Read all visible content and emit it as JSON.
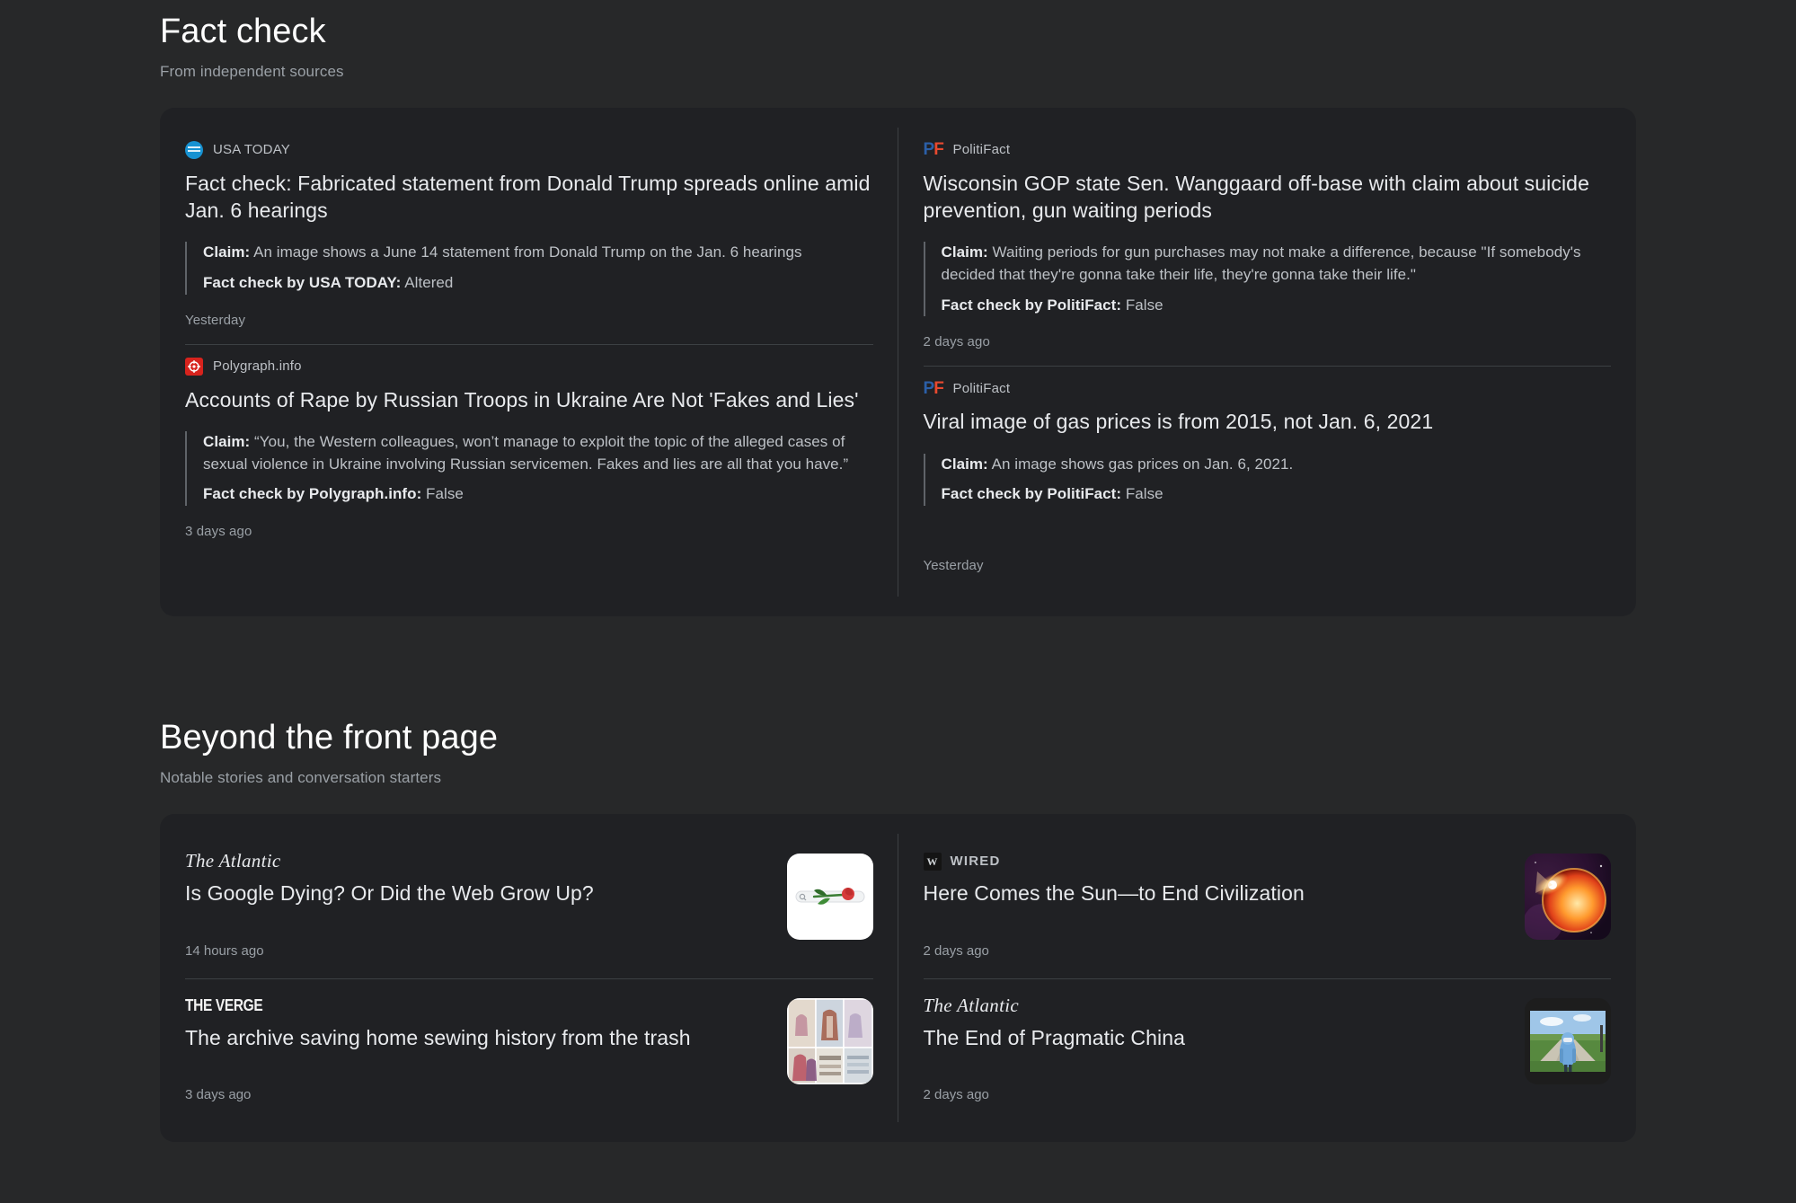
{
  "sections": {
    "fact_check": {
      "title": "Fact check",
      "subtitle": "From independent sources",
      "left": [
        {
          "source": "USA TODAY",
          "logo": "usatoday-logo",
          "headline": "Fact check: Fabricated statement from Donald Trump spreads online amid Jan. 6 hearings",
          "claim_label": "Claim:",
          "claim_text": " An image shows a June 14 statement from Donald Trump on the Jan. 6 hearings",
          "verdict_label": "Fact check by USA TODAY:",
          "verdict_text": " Altered",
          "timestamp": "Yesterday"
        },
        {
          "source": "Polygraph.info",
          "logo": "polygraph-logo",
          "headline": "Accounts of Rape by Russian Troops in Ukraine Are Not 'Fakes and Lies'",
          "claim_label": "Claim:",
          "claim_text": " “You, the Western colleagues, won’t manage to exploit the topic of the alleged cases of sexual violence in Ukraine involving Russian servicemen. Fakes and lies are all that you have.”",
          "verdict_label": "Fact check by Polygraph.info:",
          "verdict_text": " False",
          "timestamp": "3 days ago"
        }
      ],
      "right": [
        {
          "source": "PolitiFact",
          "logo": "politifact-logo",
          "headline": "Wisconsin GOP state Sen. Wanggaard off-base with claim about suicide prevention, gun waiting periods",
          "claim_label": "Claim:",
          "claim_text": " Waiting periods for gun purchases may not make a difference, because \"If somebody's decided that they're gonna take their life, they're gonna take their life.\"",
          "verdict_label": "Fact check by PolitiFact:",
          "verdict_text": " False",
          "timestamp": "2 days ago"
        },
        {
          "source": "PolitiFact",
          "logo": "politifact-logo",
          "headline": "Viral image of gas prices is from 2015, not Jan. 6, 2021",
          "claim_label": "Claim:",
          "claim_text": " An image shows gas prices on Jan. 6, 2021.",
          "verdict_label": "Fact check by PolitiFact:",
          "verdict_text": " False",
          "timestamp": "Yesterday"
        }
      ]
    },
    "beyond": {
      "title": "Beyond the front page",
      "subtitle": "Notable stories and conversation starters",
      "left": [
        {
          "source": "The Atlantic",
          "logo": "atlantic-wordmark",
          "headline": "Is Google Dying? Or Did the Web Grow Up?",
          "timestamp": "14 hours ago",
          "thumbnail": "rose-search-bar-thumbnail"
        },
        {
          "source": "THE VERGE",
          "logo": "verge-wordmark",
          "headline": "The archive saving home sewing history from the trash",
          "timestamp": "3 days ago",
          "thumbnail": "sewing-patterns-grid-thumbnail"
        }
      ],
      "right": [
        {
          "source": "WIRED",
          "logo": "wired-wordmark",
          "headline": "Here Comes the Sun—to End Civilization",
          "timestamp": "2 days ago",
          "thumbnail": "solar-flare-thumbnail"
        },
        {
          "source": "The Atlantic",
          "logo": "atlantic-wordmark",
          "headline": "The End of Pragmatic China",
          "timestamp": "2 days ago",
          "thumbnail": "hazmat-worker-field-thumbnail"
        }
      ]
    }
  },
  "colors": {
    "page_background": "#272829",
    "card_background": "#202124",
    "divider": "#3c4043",
    "title_text": "#e8eaed",
    "muted_text": "#9aa0a6",
    "body_text": "#bdc1c6",
    "politifact_blue": "#2b5fa8",
    "politifact_red": "#e8492f",
    "usatoday_blue": "#1792d2",
    "polygraph_red": "#d7231d"
  }
}
